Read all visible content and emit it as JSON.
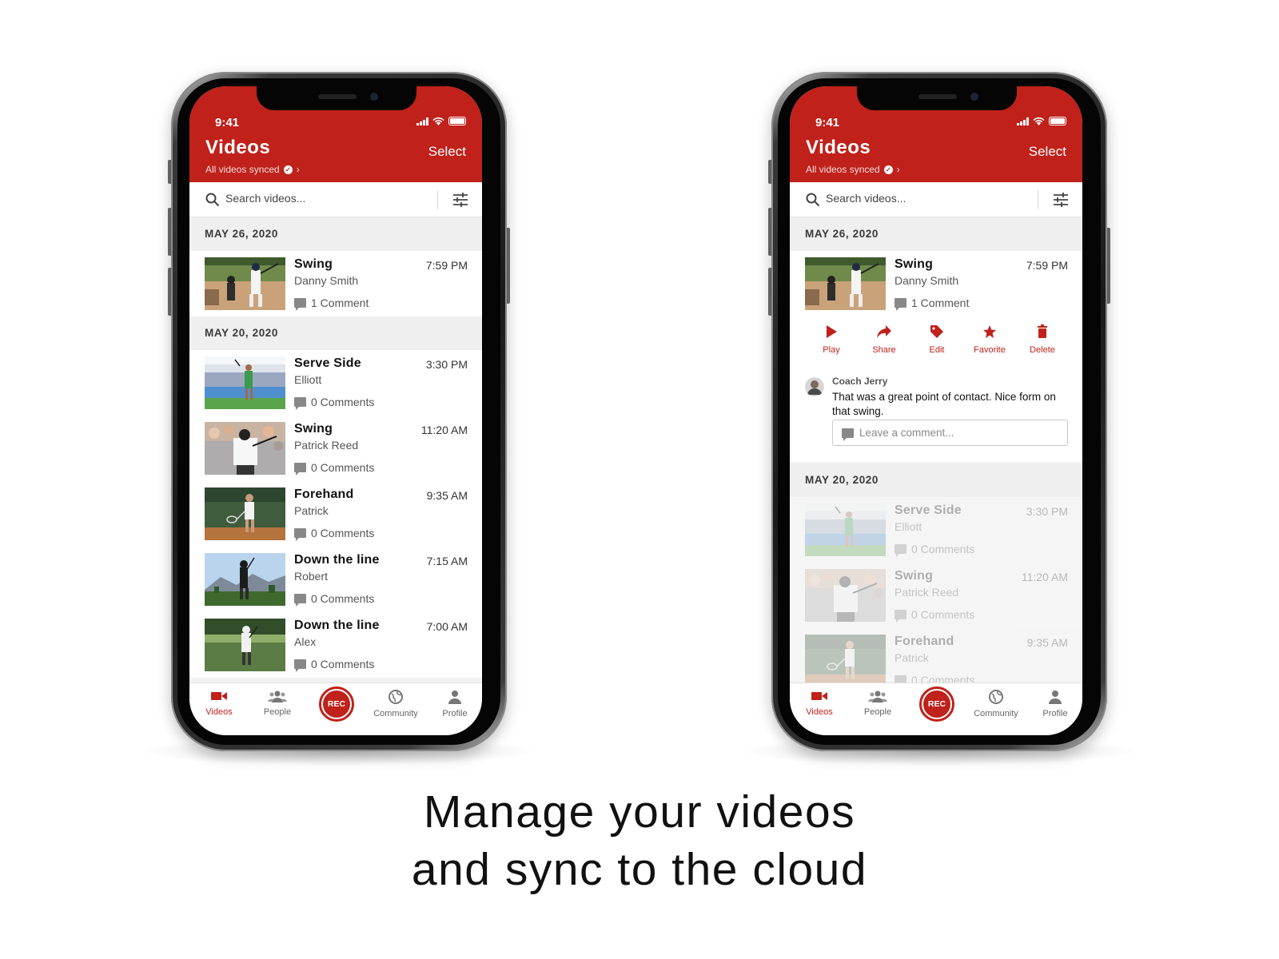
{
  "colors": {
    "brand": "#c0211b",
    "background": "#ffffff"
  },
  "caption": {
    "line1": "Manage your videos",
    "line2": "and sync to the cloud"
  },
  "app": {
    "status_time": "9:41",
    "title": "Videos",
    "select_label": "Select",
    "sync_status": "All videos synced",
    "search_placeholder": "Search videos...",
    "tabs": [
      {
        "label": "Videos",
        "icon": "video-camera-icon",
        "active": true
      },
      {
        "label": "People",
        "icon": "people-icon",
        "active": false
      },
      {
        "label": "REC",
        "icon": "record-button",
        "active": false
      },
      {
        "label": "Community",
        "icon": "globe-icon",
        "active": false
      },
      {
        "label": "Profile",
        "icon": "person-icon",
        "active": false
      }
    ]
  },
  "left_phone": {
    "sections": [
      {
        "date": "MAY 26, 2020",
        "videos": [
          {
            "title": "Swing",
            "person": "Danny Smith",
            "time": "7:59 PM",
            "comments": "1 Comment",
            "thumb": "baseball"
          }
        ]
      },
      {
        "date": "MAY 20, 2020",
        "videos": [
          {
            "title": "Serve Side",
            "person": "Elliott",
            "time": "3:30 PM",
            "comments": "0 Comments",
            "thumb": "tennis-court"
          },
          {
            "title": "Swing",
            "person": "Patrick Reed",
            "time": "11:20 AM",
            "comments": "0 Comments",
            "thumb": "golf-crowd"
          },
          {
            "title": "Forehand",
            "person": "Patrick",
            "time": "9:35 AM",
            "comments": "0 Comments",
            "thumb": "tennis-forehand"
          },
          {
            "title": "Down the line",
            "person": "Robert",
            "time": "7:15 AM",
            "comments": "0 Comments",
            "thumb": "golf-mountains"
          },
          {
            "title": "Down the line",
            "person": "Alex",
            "time": "7:00 AM",
            "comments": "0 Comments",
            "thumb": "golf-fairway"
          }
        ]
      }
    ]
  },
  "right_phone": {
    "sections": [
      {
        "date": "MAY 26, 2020",
        "videos": [
          {
            "title": "Swing",
            "person": "Danny Smith",
            "time": "7:59 PM",
            "comments": "1 Comment",
            "thumb": "baseball"
          }
        ]
      },
      {
        "date": "MAY 20, 2020",
        "videos": [
          {
            "title": "Serve Side",
            "person": "Elliott",
            "time": "3:30 PM",
            "comments": "0 Comments",
            "thumb": "tennis-court"
          },
          {
            "title": "Swing",
            "person": "Patrick Reed",
            "time": "11:20 AM",
            "comments": "0 Comments",
            "thumb": "golf-crowd"
          },
          {
            "title": "Forehand",
            "person": "Patrick",
            "time": "9:35 AM",
            "comments": "0 Comments",
            "thumb": "tennis-forehand"
          }
        ]
      }
    ],
    "actions": [
      {
        "label": "Play",
        "icon": "play-icon"
      },
      {
        "label": "Share",
        "icon": "share-icon"
      },
      {
        "label": "Edit",
        "icon": "tag-icon"
      },
      {
        "label": "Favorite",
        "icon": "star-icon"
      },
      {
        "label": "Delete",
        "icon": "trash-icon"
      }
    ],
    "comment": {
      "author": "Coach Jerry",
      "text": "That was a great point of contact. Nice form on that swing.",
      "input_placeholder": "Leave a comment..."
    }
  }
}
